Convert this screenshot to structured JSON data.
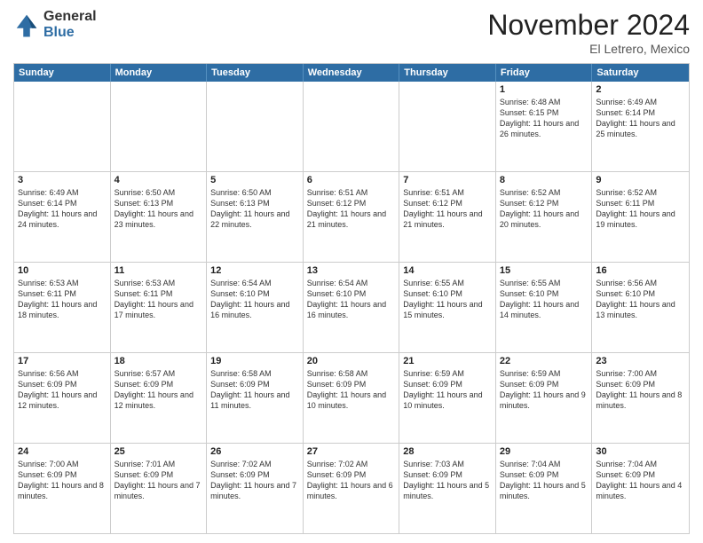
{
  "header": {
    "logo_general": "General",
    "logo_blue": "Blue",
    "month_title": "November 2024",
    "location": "El Letrero, Mexico"
  },
  "calendar": {
    "days_of_week": [
      "Sunday",
      "Monday",
      "Tuesday",
      "Wednesday",
      "Thursday",
      "Friday",
      "Saturday"
    ],
    "rows": [
      [
        {
          "day": "",
          "text": ""
        },
        {
          "day": "",
          "text": ""
        },
        {
          "day": "",
          "text": ""
        },
        {
          "day": "",
          "text": ""
        },
        {
          "day": "",
          "text": ""
        },
        {
          "day": "1",
          "text": "Sunrise: 6:48 AM\nSunset: 6:15 PM\nDaylight: 11 hours and 26 minutes."
        },
        {
          "day": "2",
          "text": "Sunrise: 6:49 AM\nSunset: 6:14 PM\nDaylight: 11 hours and 25 minutes."
        }
      ],
      [
        {
          "day": "3",
          "text": "Sunrise: 6:49 AM\nSunset: 6:14 PM\nDaylight: 11 hours and 24 minutes."
        },
        {
          "day": "4",
          "text": "Sunrise: 6:50 AM\nSunset: 6:13 PM\nDaylight: 11 hours and 23 minutes."
        },
        {
          "day": "5",
          "text": "Sunrise: 6:50 AM\nSunset: 6:13 PM\nDaylight: 11 hours and 22 minutes."
        },
        {
          "day": "6",
          "text": "Sunrise: 6:51 AM\nSunset: 6:12 PM\nDaylight: 11 hours and 21 minutes."
        },
        {
          "day": "7",
          "text": "Sunrise: 6:51 AM\nSunset: 6:12 PM\nDaylight: 11 hours and 21 minutes."
        },
        {
          "day": "8",
          "text": "Sunrise: 6:52 AM\nSunset: 6:12 PM\nDaylight: 11 hours and 20 minutes."
        },
        {
          "day": "9",
          "text": "Sunrise: 6:52 AM\nSunset: 6:11 PM\nDaylight: 11 hours and 19 minutes."
        }
      ],
      [
        {
          "day": "10",
          "text": "Sunrise: 6:53 AM\nSunset: 6:11 PM\nDaylight: 11 hours and 18 minutes."
        },
        {
          "day": "11",
          "text": "Sunrise: 6:53 AM\nSunset: 6:11 PM\nDaylight: 11 hours and 17 minutes."
        },
        {
          "day": "12",
          "text": "Sunrise: 6:54 AM\nSunset: 6:10 PM\nDaylight: 11 hours and 16 minutes."
        },
        {
          "day": "13",
          "text": "Sunrise: 6:54 AM\nSunset: 6:10 PM\nDaylight: 11 hours and 16 minutes."
        },
        {
          "day": "14",
          "text": "Sunrise: 6:55 AM\nSunset: 6:10 PM\nDaylight: 11 hours and 15 minutes."
        },
        {
          "day": "15",
          "text": "Sunrise: 6:55 AM\nSunset: 6:10 PM\nDaylight: 11 hours and 14 minutes."
        },
        {
          "day": "16",
          "text": "Sunrise: 6:56 AM\nSunset: 6:10 PM\nDaylight: 11 hours and 13 minutes."
        }
      ],
      [
        {
          "day": "17",
          "text": "Sunrise: 6:56 AM\nSunset: 6:09 PM\nDaylight: 11 hours and 12 minutes."
        },
        {
          "day": "18",
          "text": "Sunrise: 6:57 AM\nSunset: 6:09 PM\nDaylight: 11 hours and 12 minutes."
        },
        {
          "day": "19",
          "text": "Sunrise: 6:58 AM\nSunset: 6:09 PM\nDaylight: 11 hours and 11 minutes."
        },
        {
          "day": "20",
          "text": "Sunrise: 6:58 AM\nSunset: 6:09 PM\nDaylight: 11 hours and 10 minutes."
        },
        {
          "day": "21",
          "text": "Sunrise: 6:59 AM\nSunset: 6:09 PM\nDaylight: 11 hours and 10 minutes."
        },
        {
          "day": "22",
          "text": "Sunrise: 6:59 AM\nSunset: 6:09 PM\nDaylight: 11 hours and 9 minutes."
        },
        {
          "day": "23",
          "text": "Sunrise: 7:00 AM\nSunset: 6:09 PM\nDaylight: 11 hours and 8 minutes."
        }
      ],
      [
        {
          "day": "24",
          "text": "Sunrise: 7:00 AM\nSunset: 6:09 PM\nDaylight: 11 hours and 8 minutes."
        },
        {
          "day": "25",
          "text": "Sunrise: 7:01 AM\nSunset: 6:09 PM\nDaylight: 11 hours and 7 minutes."
        },
        {
          "day": "26",
          "text": "Sunrise: 7:02 AM\nSunset: 6:09 PM\nDaylight: 11 hours and 7 minutes."
        },
        {
          "day": "27",
          "text": "Sunrise: 7:02 AM\nSunset: 6:09 PM\nDaylight: 11 hours and 6 minutes."
        },
        {
          "day": "28",
          "text": "Sunrise: 7:03 AM\nSunset: 6:09 PM\nDaylight: 11 hours and 5 minutes."
        },
        {
          "day": "29",
          "text": "Sunrise: 7:04 AM\nSunset: 6:09 PM\nDaylight: 11 hours and 5 minutes."
        },
        {
          "day": "30",
          "text": "Sunrise: 7:04 AM\nSunset: 6:09 PM\nDaylight: 11 hours and 4 minutes."
        }
      ]
    ]
  }
}
